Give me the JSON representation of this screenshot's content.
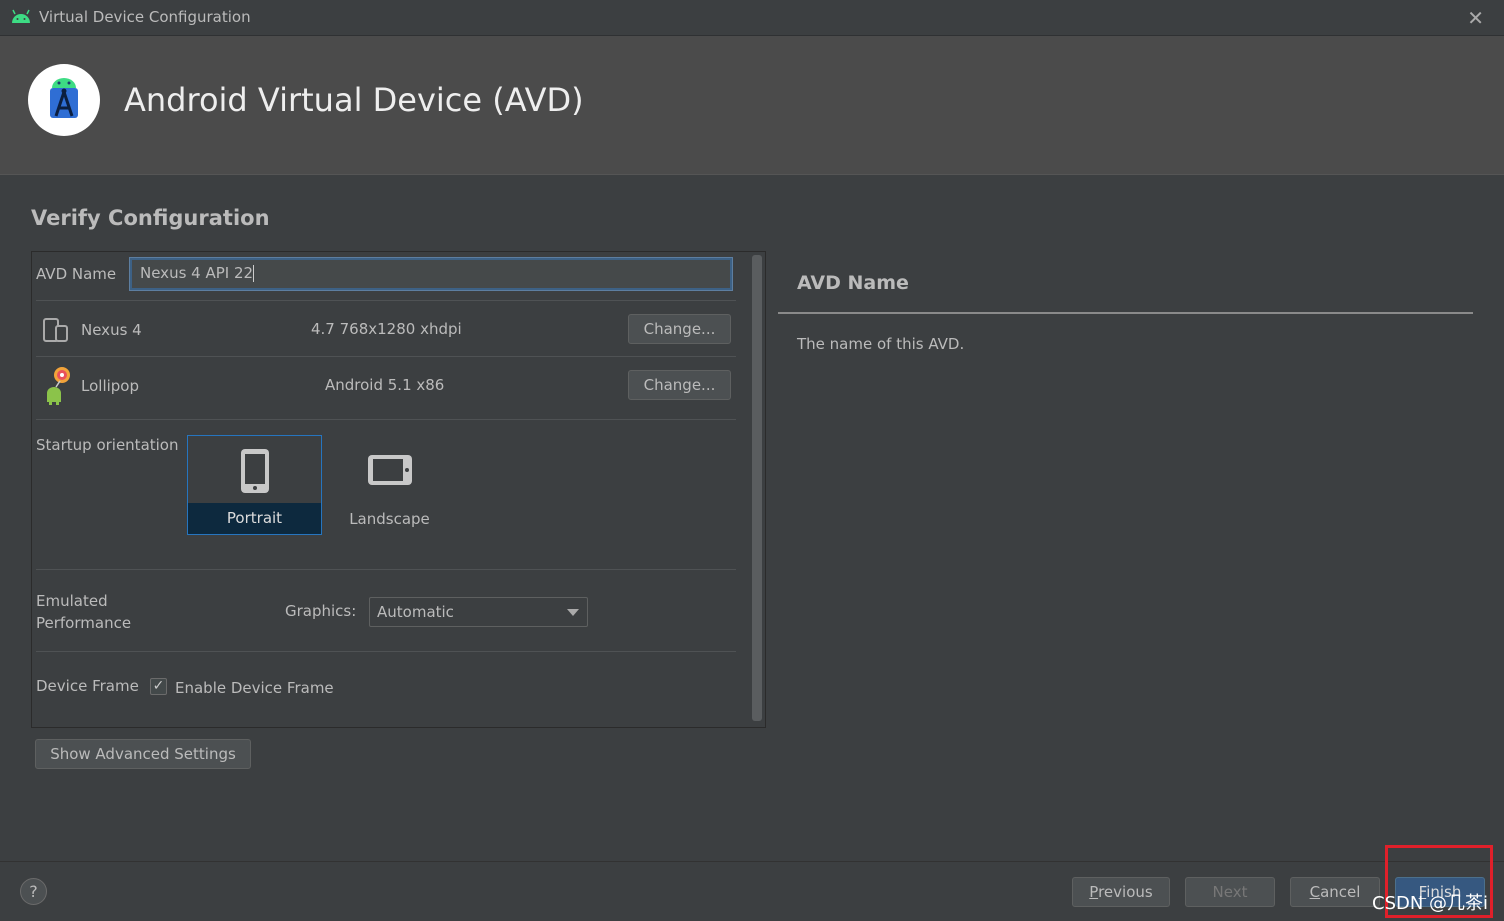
{
  "window": {
    "title": "Virtual Device Configuration",
    "close_glyph": "✕"
  },
  "banner": {
    "heading": "Android Virtual Device (AVD)"
  },
  "section": {
    "title": "Verify Configuration"
  },
  "avd_name": {
    "label": "AVD Name",
    "value": "Nexus 4 API 22"
  },
  "device": {
    "name": "Nexus 4",
    "spec": "4.7 768x1280 xhdpi",
    "change_label": "Change..."
  },
  "system_image": {
    "name": "Lollipop",
    "spec": "Android 5.1 x86",
    "change_label": "Change..."
  },
  "orientation": {
    "label": "Startup orientation",
    "options": [
      {
        "label": "Portrait",
        "selected": true
      },
      {
        "label": "Landscape",
        "selected": false
      }
    ]
  },
  "performance": {
    "label_line1": "Emulated",
    "label_line2": "Performance",
    "graphics_label": "Graphics:",
    "graphics_value": "Automatic"
  },
  "device_frame": {
    "label": "Device Frame",
    "checkbox_label": "Enable Device Frame",
    "checked": true,
    "check_glyph": "✓"
  },
  "advanced_button": "Show Advanced Settings",
  "help_panel": {
    "title": "AVD Name",
    "text": "The name of this AVD."
  },
  "footer": {
    "help_glyph": "?",
    "previous": "Previous",
    "next": "Next",
    "cancel": "Cancel",
    "finish": "Finish"
  },
  "watermark": "CSDN @几茶i",
  "colors": {
    "accent": "#3d6185",
    "selection": "#0d293e",
    "highlight_box": "#e0202a"
  }
}
